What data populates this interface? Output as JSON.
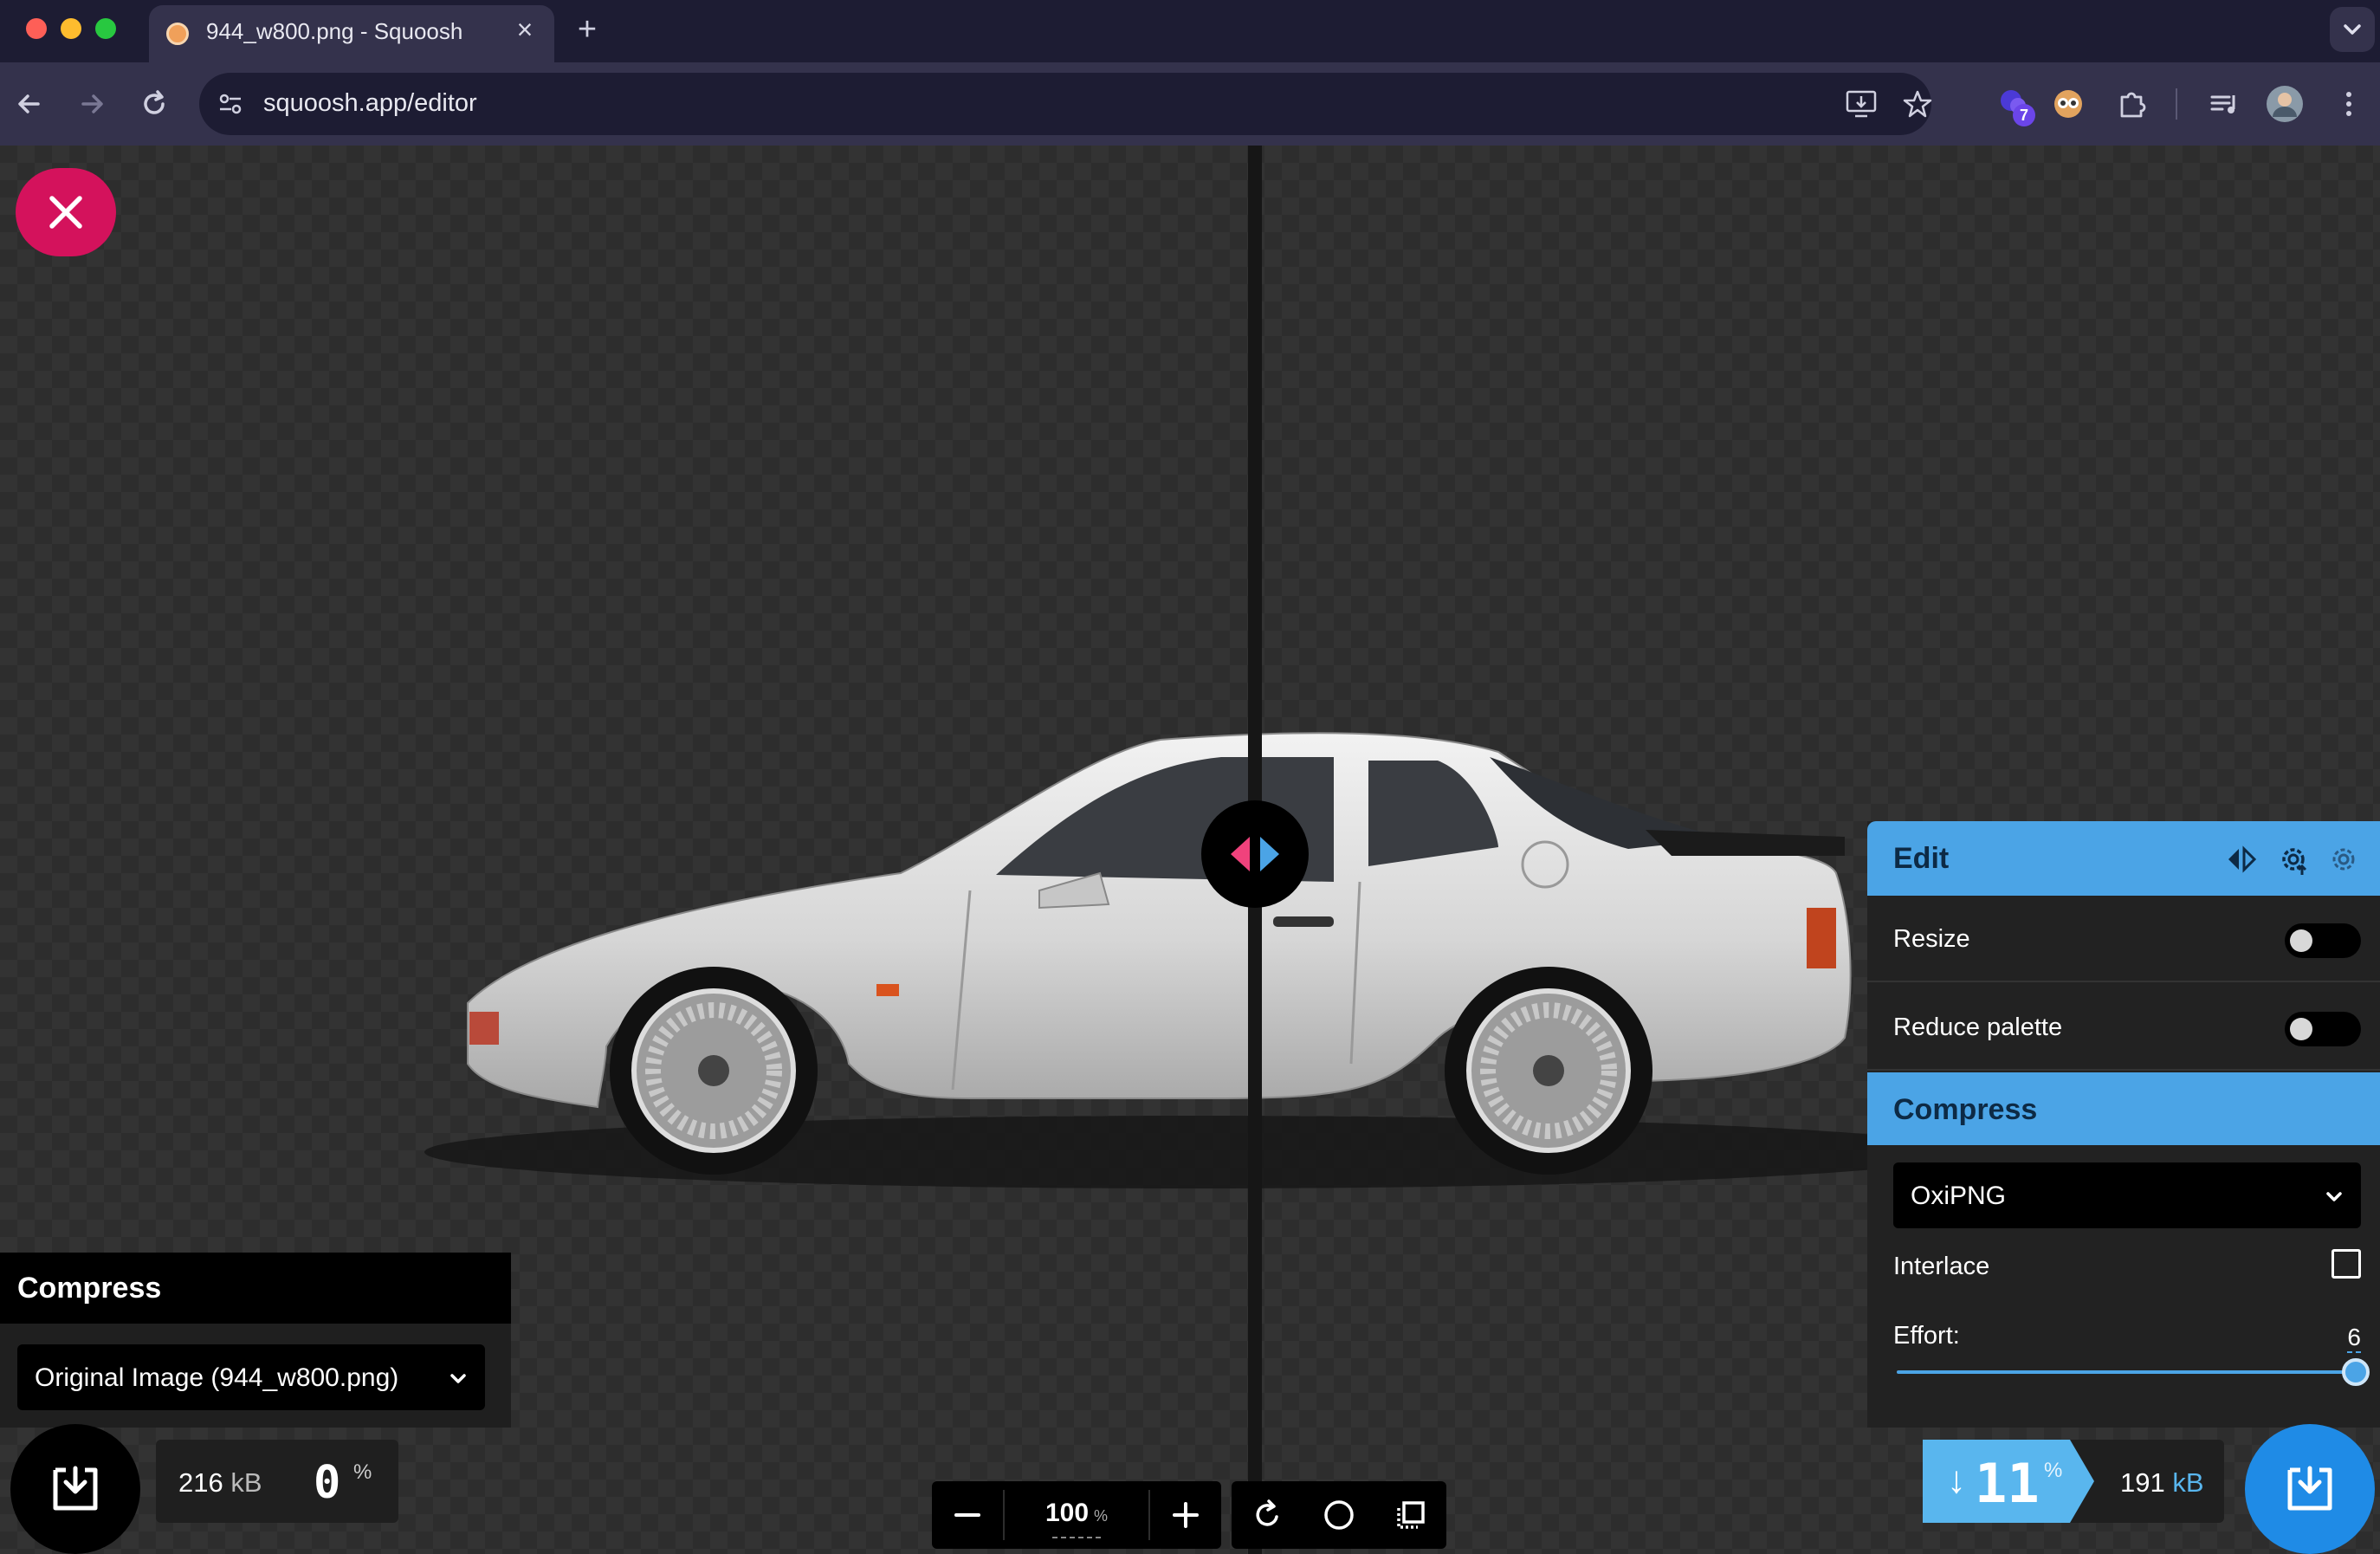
{
  "browser": {
    "tab_title": "944_w800.png - Squoosh",
    "url": "squoosh.app/editor",
    "extension_badge": "7",
    "colors": {
      "frame": "#1d1c33",
      "toolbar": "#34324c"
    }
  },
  "icons": {
    "back": "arrow-left-icon",
    "forward": "arrow-right-icon",
    "reload": "reload-icon",
    "site_info": "tune-icon",
    "install": "install-icon",
    "bookmark": "star-icon",
    "extensions": "puzzle-icon",
    "media": "media-queue-icon",
    "menu": "kebab-menu-icon"
  },
  "editor": {
    "left": {
      "panel_title": "Compress",
      "selected_option": "Original Image (944_w800.png)",
      "size_value": "216",
      "size_unit": "kB",
      "percent_value": "0",
      "percent_sign": "%"
    },
    "zoom": {
      "value": "100",
      "unit": "%"
    },
    "right": {
      "edit_title": "Edit",
      "resize_label": "Resize",
      "resize_on": false,
      "reduce_palette_label": "Reduce palette",
      "reduce_palette_on": false,
      "compress_title": "Compress",
      "codec": "OxiPNG",
      "interlace_label": "Interlace",
      "interlace_checked": false,
      "effort_label": "Effort:",
      "effort_value": "6",
      "effort_fraction": 1.0,
      "delta_arrow": "↓",
      "delta_value": "11",
      "delta_sign": "%",
      "size_value": "191",
      "size_unit": "kB"
    },
    "colors": {
      "close_button": "#d4125c",
      "accent_blue": "#4ba4e6",
      "download_blue": "#1f8be6"
    }
  }
}
